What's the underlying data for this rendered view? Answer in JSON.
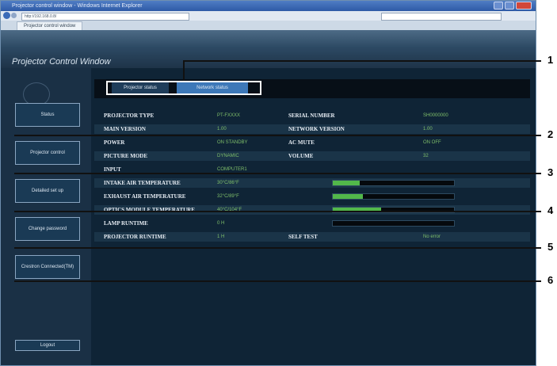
{
  "browser": {
    "title": "Projector control window - Windows Internet Explorer",
    "address": "http://192.168.0.8/",
    "tab_label": "Projector control window"
  },
  "app": {
    "title": "Projector Control Window"
  },
  "sidebar": {
    "items": [
      {
        "label": "Status"
      },
      {
        "label": "Projector control"
      },
      {
        "label": "Detailed set up"
      },
      {
        "label": "Change password"
      },
      {
        "label": "Crestron Connected(TM)"
      }
    ],
    "footer_label": "Logout"
  },
  "tabs": [
    {
      "label": "Projector status"
    },
    {
      "label": "Network status"
    }
  ],
  "status_rows": [
    {
      "label_left": "PROJECTOR TYPE",
      "value_left": "PT-FXXXX",
      "label_right": "SERIAL NUMBER",
      "value_right": "SH0000000",
      "bar": null
    },
    {
      "label_left": "MAIN VERSION",
      "value_left": "1.00",
      "label_right": "NETWORK VERSION",
      "value_right": "1.00",
      "bar": null
    },
    {
      "label_left": "POWER",
      "value_left": "ON STANDBY",
      "label_right": "AC MUTE",
      "value_right": "ON OFF",
      "bar": null
    },
    {
      "label_left": "PICTURE MODE",
      "value_left": "DYNAMIC",
      "label_right": "VOLUME",
      "value_right": "32",
      "bar": null
    },
    {
      "label_left": "INPUT",
      "value_left": "COMPUTER1",
      "label_right": "",
      "value_right": "",
      "bar": null
    },
    {
      "label_left": "INTAKE AIR TEMPERATURE",
      "value_left": "30°C/86°F",
      "label_right": "",
      "value_right": "",
      "bar": 0.22
    },
    {
      "label_left": "EXHAUST AIR TEMPERATURE",
      "value_left": "32°C/89°F",
      "label_right": "",
      "value_right": "",
      "bar": 0.25
    },
    {
      "label_left": "OPTICS MODULE TEMPERATURE",
      "value_left": "40°C/104°F",
      "label_right": "",
      "value_right": "",
      "bar": 0.4
    },
    {
      "label_left": "LAMP RUNTIME",
      "value_left": "0 H",
      "label_right": "",
      "value_right": "",
      "bar": 0.0
    },
    {
      "label_left": "PROJECTOR RUNTIME",
      "value_left": "1 H",
      "label_right": "SELF TEST",
      "value_right": "No error",
      "bar": null
    }
  ],
  "callouts": [
    "1",
    "2",
    "3",
    "4",
    "5",
    "6"
  ]
}
